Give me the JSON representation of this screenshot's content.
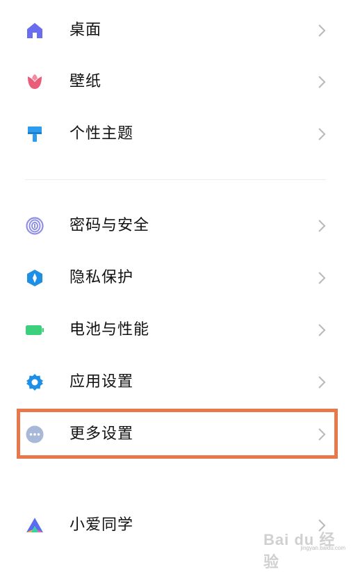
{
  "settings_list": {
    "items": [
      {
        "label": "桌面",
        "icon": "home-icon",
        "color": "#6a6df0"
      },
      {
        "label": "壁纸",
        "icon": "tulip-icon",
        "color": "#e95d7a"
      },
      {
        "label": "个性主题",
        "icon": "paintbrush-icon",
        "color": "#2c9bf0"
      },
      {
        "label": "密码与安全",
        "icon": "fingerprint-icon",
        "color": "#8f8fe6"
      },
      {
        "label": "隐私保护",
        "icon": "privacy-shield-icon",
        "color": "#1d8fe5"
      },
      {
        "label": "电池与性能",
        "icon": "battery-icon",
        "color": "#3ccf7c"
      },
      {
        "label": "应用设置",
        "icon": "gear-icon",
        "color": "#1d8fe5"
      },
      {
        "label": "更多设置",
        "icon": "more-dots-icon",
        "color": "#a8b8d8"
      },
      {
        "label": "小爱同学",
        "icon": "xiaoai-icon",
        "color": "#5b6cf0"
      }
    ]
  },
  "highlight": {
    "color": "#e8784c",
    "target_label": "更多设置"
  },
  "watermark": {
    "text": "Bai du 经验",
    "subtext": "jingyan.baidu.com"
  }
}
